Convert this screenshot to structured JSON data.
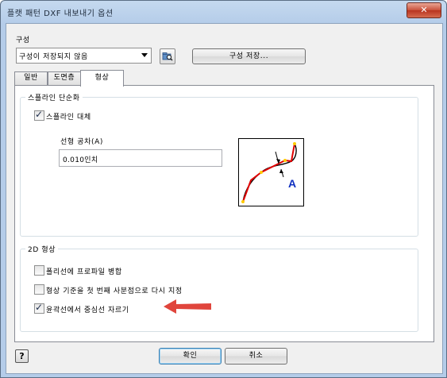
{
  "window": {
    "title": "플랫 패턴 DXF 내보내기 옵션",
    "close_label": "✕"
  },
  "config": {
    "label": "구성",
    "selected": "구성이 저장되지 않음",
    "save_button": "구성 저장..."
  },
  "tabs": [
    {
      "label": "일반",
      "active": false
    },
    {
      "label": "도면층",
      "active": false
    },
    {
      "label": "형상",
      "active": true
    }
  ],
  "spline_group": {
    "title": "스플라인 단순화",
    "replace_checkbox": {
      "label": "스플라인 대체",
      "checked": true
    },
    "tolerance_label": "선형 공차(A)",
    "tolerance_value": "0.010인치",
    "diagram_letter": "A"
  },
  "shape_group": {
    "title": "2D 형상",
    "options": [
      {
        "label": "폴리선에 프로파일 병합",
        "checked": false
      },
      {
        "label": "형상 기준을 첫 번째 사분점으로 다시 지정",
        "checked": false
      },
      {
        "label": "윤곽선에서 중심선 자르기",
        "checked": true
      }
    ]
  },
  "footer": {
    "help_icon_glyph": "?",
    "ok_label": "확인",
    "cancel_label": "취소"
  },
  "colors": {
    "annotation_arrow": "#e0453c",
    "curve_red": "#e00000",
    "point_yellow": "#ffcc00",
    "letter_blue": "#1030c0"
  }
}
